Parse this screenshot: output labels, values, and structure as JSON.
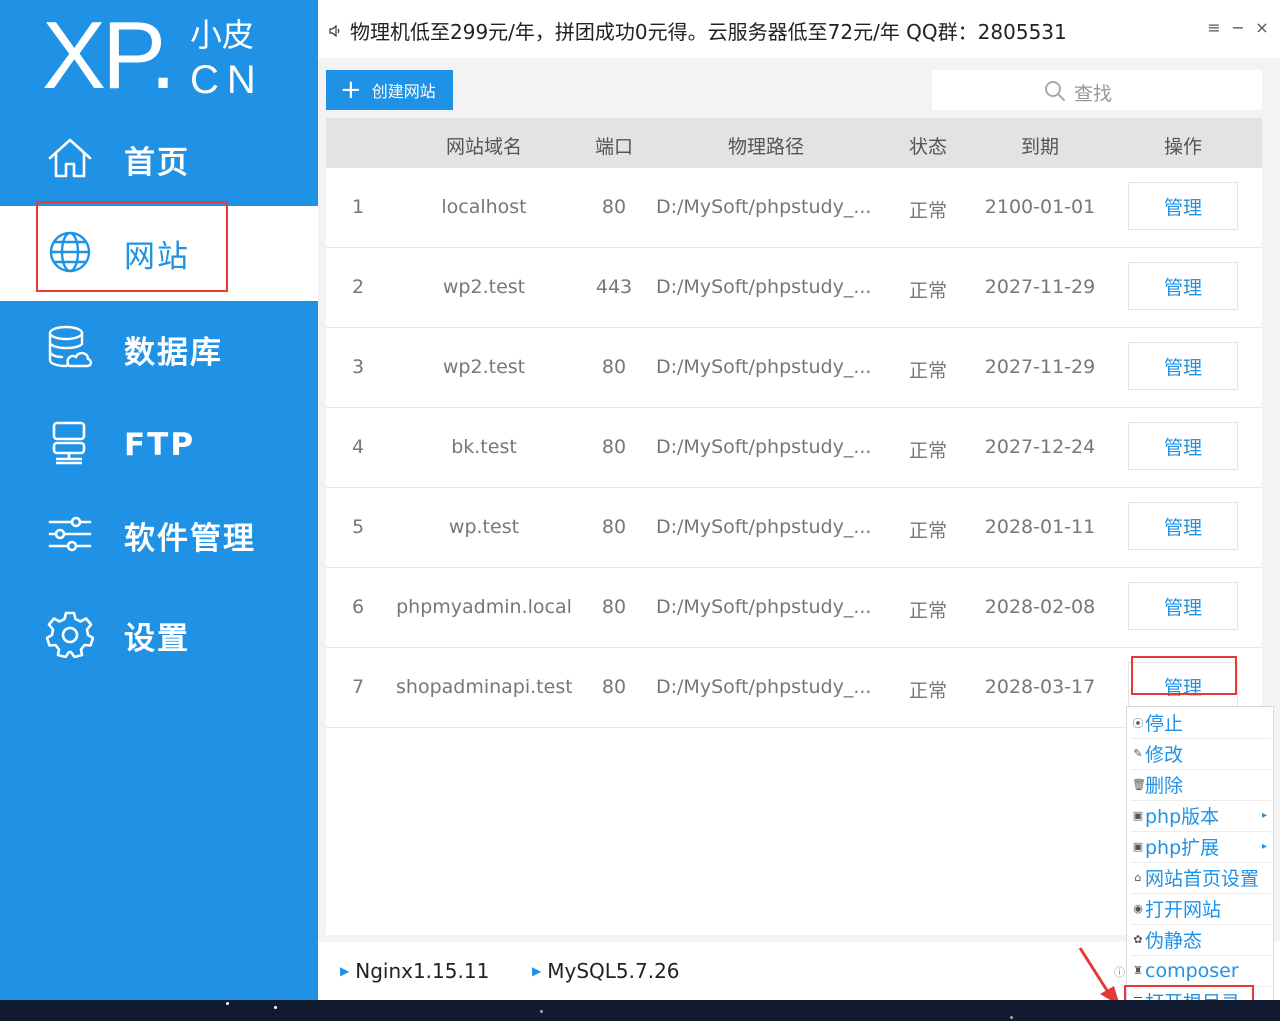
{
  "logo": {
    "main": "XP.",
    "small": "小皮",
    "cn": "CN"
  },
  "sidebar": {
    "items": [
      {
        "label": "首页",
        "icon": "home-icon",
        "active": false
      },
      {
        "label": "网站",
        "icon": "globe-icon",
        "active": true
      },
      {
        "label": "数据库",
        "icon": "database-icon",
        "active": false
      },
      {
        "label": "FTP",
        "icon": "server-icon",
        "active": false
      },
      {
        "label": "软件管理",
        "icon": "sliders-icon",
        "active": false
      },
      {
        "label": "设置",
        "icon": "gear-icon",
        "active": false
      }
    ]
  },
  "topbar": {
    "notice": "物理机低至299元/年，拼团成功0元得。云服务器低至72元/年  QQ群：2805531",
    "menu_icon": "≡",
    "minimize_icon": "−",
    "close_icon": "×"
  },
  "toolbar": {
    "create_label": "创建网站",
    "search_placeholder": "查找"
  },
  "table": {
    "headers": {
      "domain": "网站域名",
      "port": "端口",
      "path": "物理路径",
      "status": "状态",
      "expire": "到期",
      "action": "操作"
    },
    "rows": [
      {
        "num": "1",
        "domain": "localhost",
        "port": "80",
        "path": "D:/MySoft/phpstudy_...",
        "status": "正常",
        "expire": "2100-01-01",
        "action": "管理"
      },
      {
        "num": "2",
        "domain": "wp2.test",
        "port": "443",
        "path": "D:/MySoft/phpstudy_...",
        "status": "正常",
        "expire": "2027-11-29",
        "action": "管理"
      },
      {
        "num": "3",
        "domain": "wp2.test",
        "port": "80",
        "path": "D:/MySoft/phpstudy_...",
        "status": "正常",
        "expire": "2027-11-29",
        "action": "管理"
      },
      {
        "num": "4",
        "domain": "bk.test",
        "port": "80",
        "path": "D:/MySoft/phpstudy_...",
        "status": "正常",
        "expire": "2027-12-24",
        "action": "管理"
      },
      {
        "num": "5",
        "domain": "wp.test",
        "port": "80",
        "path": "D:/MySoft/phpstudy_...",
        "status": "正常",
        "expire": "2028-01-11",
        "action": "管理"
      },
      {
        "num": "6",
        "domain": "phpmyadmin.local",
        "port": "80",
        "path": "D:/MySoft/phpstudy_...",
        "status": "正常",
        "expire": "2028-02-08",
        "action": "管理"
      },
      {
        "num": "7",
        "domain": "shopadminapi.test",
        "port": "80",
        "path": "D:/MySoft/phpstudy_...",
        "status": "正常",
        "expire": "2028-03-17",
        "action": "管理"
      }
    ]
  },
  "statusbar": {
    "nginx": "Nginx1.15.11",
    "mysql": "MySQL5.7.26"
  },
  "context_menu": {
    "items": [
      {
        "label": "停止",
        "icon": "stop-icon",
        "glyph": "⦿",
        "submenu": false
      },
      {
        "label": "修改",
        "icon": "edit-icon",
        "glyph": "✎",
        "submenu": false
      },
      {
        "label": "删除",
        "icon": "trash-icon",
        "glyph": "🗑",
        "submenu": false
      },
      {
        "label": "php版本",
        "icon": "php-version-icon",
        "glyph": "▣",
        "submenu": true
      },
      {
        "label": "php扩展",
        "icon": "php-extension-icon",
        "glyph": "▣",
        "submenu": true
      },
      {
        "label": "网站首页设置",
        "icon": "homepage-icon",
        "glyph": "⌂",
        "submenu": false
      },
      {
        "label": "打开网站",
        "icon": "open-site-icon",
        "glyph": "◉",
        "submenu": false
      },
      {
        "label": "伪静态",
        "icon": "rewrite-icon",
        "glyph": "✿",
        "submenu": false
      },
      {
        "label": "composer",
        "icon": "composer-icon",
        "glyph": "♜",
        "submenu": false
      },
      {
        "label": "打开根目录",
        "icon": "open-root-icon",
        "glyph": "☰",
        "submenu": false
      }
    ],
    "help_glyph": "ⓘ"
  },
  "colors": {
    "brand": "#1f92e6",
    "highlight": "#e53935",
    "header_bg": "#e3e3e3"
  }
}
